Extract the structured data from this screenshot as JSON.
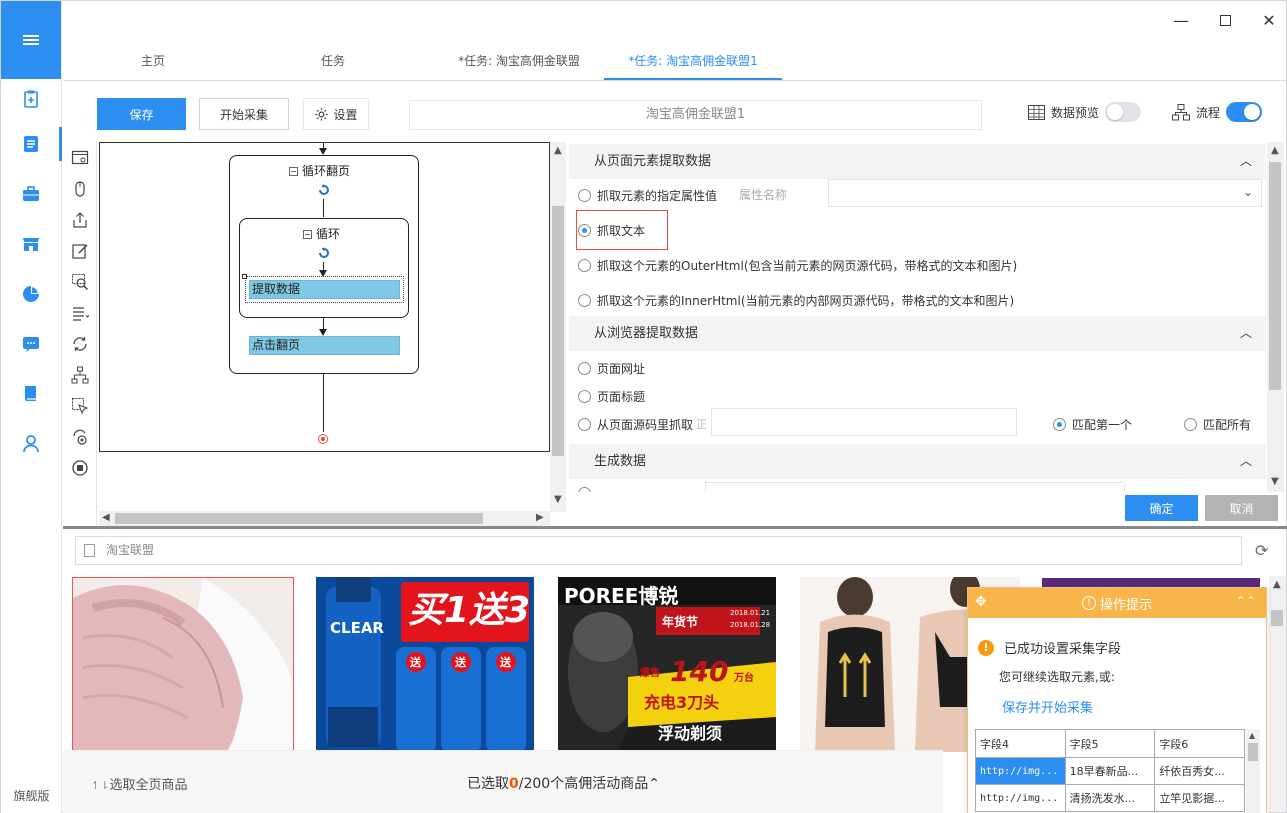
{
  "window": {
    "controls": [
      "minimize",
      "maximize",
      "close"
    ]
  },
  "sidebar": {
    "items": [
      {
        "icon": "clipboard-add-icon"
      },
      {
        "icon": "document-icon",
        "active": true
      },
      {
        "icon": "briefcase-icon"
      },
      {
        "icon": "store-icon"
      },
      {
        "icon": "pie-chart-icon"
      },
      {
        "icon": "chat-icon"
      },
      {
        "icon": "book-icon"
      },
      {
        "icon": "user-icon"
      }
    ],
    "edition": "旗舰版"
  },
  "tabs": [
    {
      "label": "主页"
    },
    {
      "label": "任务"
    },
    {
      "label": "*任务: 淘宝高佣金联盟"
    },
    {
      "label": "*任务: 淘宝高佣金联盟1",
      "active": true
    }
  ],
  "toolbar": {
    "save": "保存",
    "start": "开始采集",
    "settings": "设置",
    "task_name": "淘宝高佣金联盟1",
    "data_preview": "数据预览",
    "data_preview_on": false,
    "flow": "流程",
    "flow_on": true
  },
  "workflow": {
    "loop_page": "循环翻页",
    "loop": "循环",
    "extract": "提取数据",
    "click_next": "点击翻页"
  },
  "panel": {
    "section1": {
      "title": "从页面元素提取数据",
      "opt_attr": "抓取元素的指定属性值",
      "attr_label": "属性名称",
      "opt_text": "抓取文本",
      "opt_outer": "抓取这个元素的OuterHtml(包含当前元素的网页源代码，带格式的文本和图片)",
      "opt_inner": "抓取这个元素的InnerHtml(当前元素的内部网页源代码，带格式的文本和图片)",
      "selected": "抓取文本"
    },
    "section2": {
      "title": "从浏览器提取数据",
      "opt_url": "页面网址",
      "opt_title": "页面标题",
      "opt_source": "从页面源码里抓取",
      "source_hint": "正",
      "match_first": "匹配第一个",
      "match_all": "匹配所有"
    },
    "section3": {
      "title": "生成数据"
    },
    "ok": "确定",
    "cancel": "取消"
  },
  "browser": {
    "url": "淘宝联盟",
    "select_all": "选取全页商品",
    "selected_prefix": "已选取",
    "selected_count": "0",
    "selected_suffix": "/200个高佣活动商品",
    "products": [
      {
        "alt": "pink knit sweater"
      },
      {
        "alt": "CLEAR shampoo",
        "text1": "买1送3",
        "brand": "CLEAR",
        "gift": "送"
      },
      {
        "alt": "POREE shaver",
        "brand": "POREE博锐",
        "promo": "年货节",
        "date1": "2018.01.21",
        "date2": "2018.01.28",
        "price": "140",
        "unit": "万台",
        "explode": "爆售",
        "slogan1": "充电3刀头",
        "slogan2": "浮动剃须"
      },
      {
        "alt": "posture corrector"
      }
    ]
  },
  "tips": {
    "title": "操作提示",
    "message": "已成功设置采集字段",
    "sub": "您可继续选取元素,或:",
    "link": "保存并开始采集",
    "headers": [
      "字段4",
      "字段5",
      "字段6"
    ],
    "rows": [
      [
        "http://img...",
        "18早春新品...",
        "纤依百秀女..."
      ],
      [
        "http://img...",
        "清扬洗发水...",
        "立竿见影据..."
      ]
    ]
  },
  "colors": {
    "accent": "#2b8ef0",
    "tips_header": "#f7b54a",
    "highlight": "#e74c3c"
  }
}
